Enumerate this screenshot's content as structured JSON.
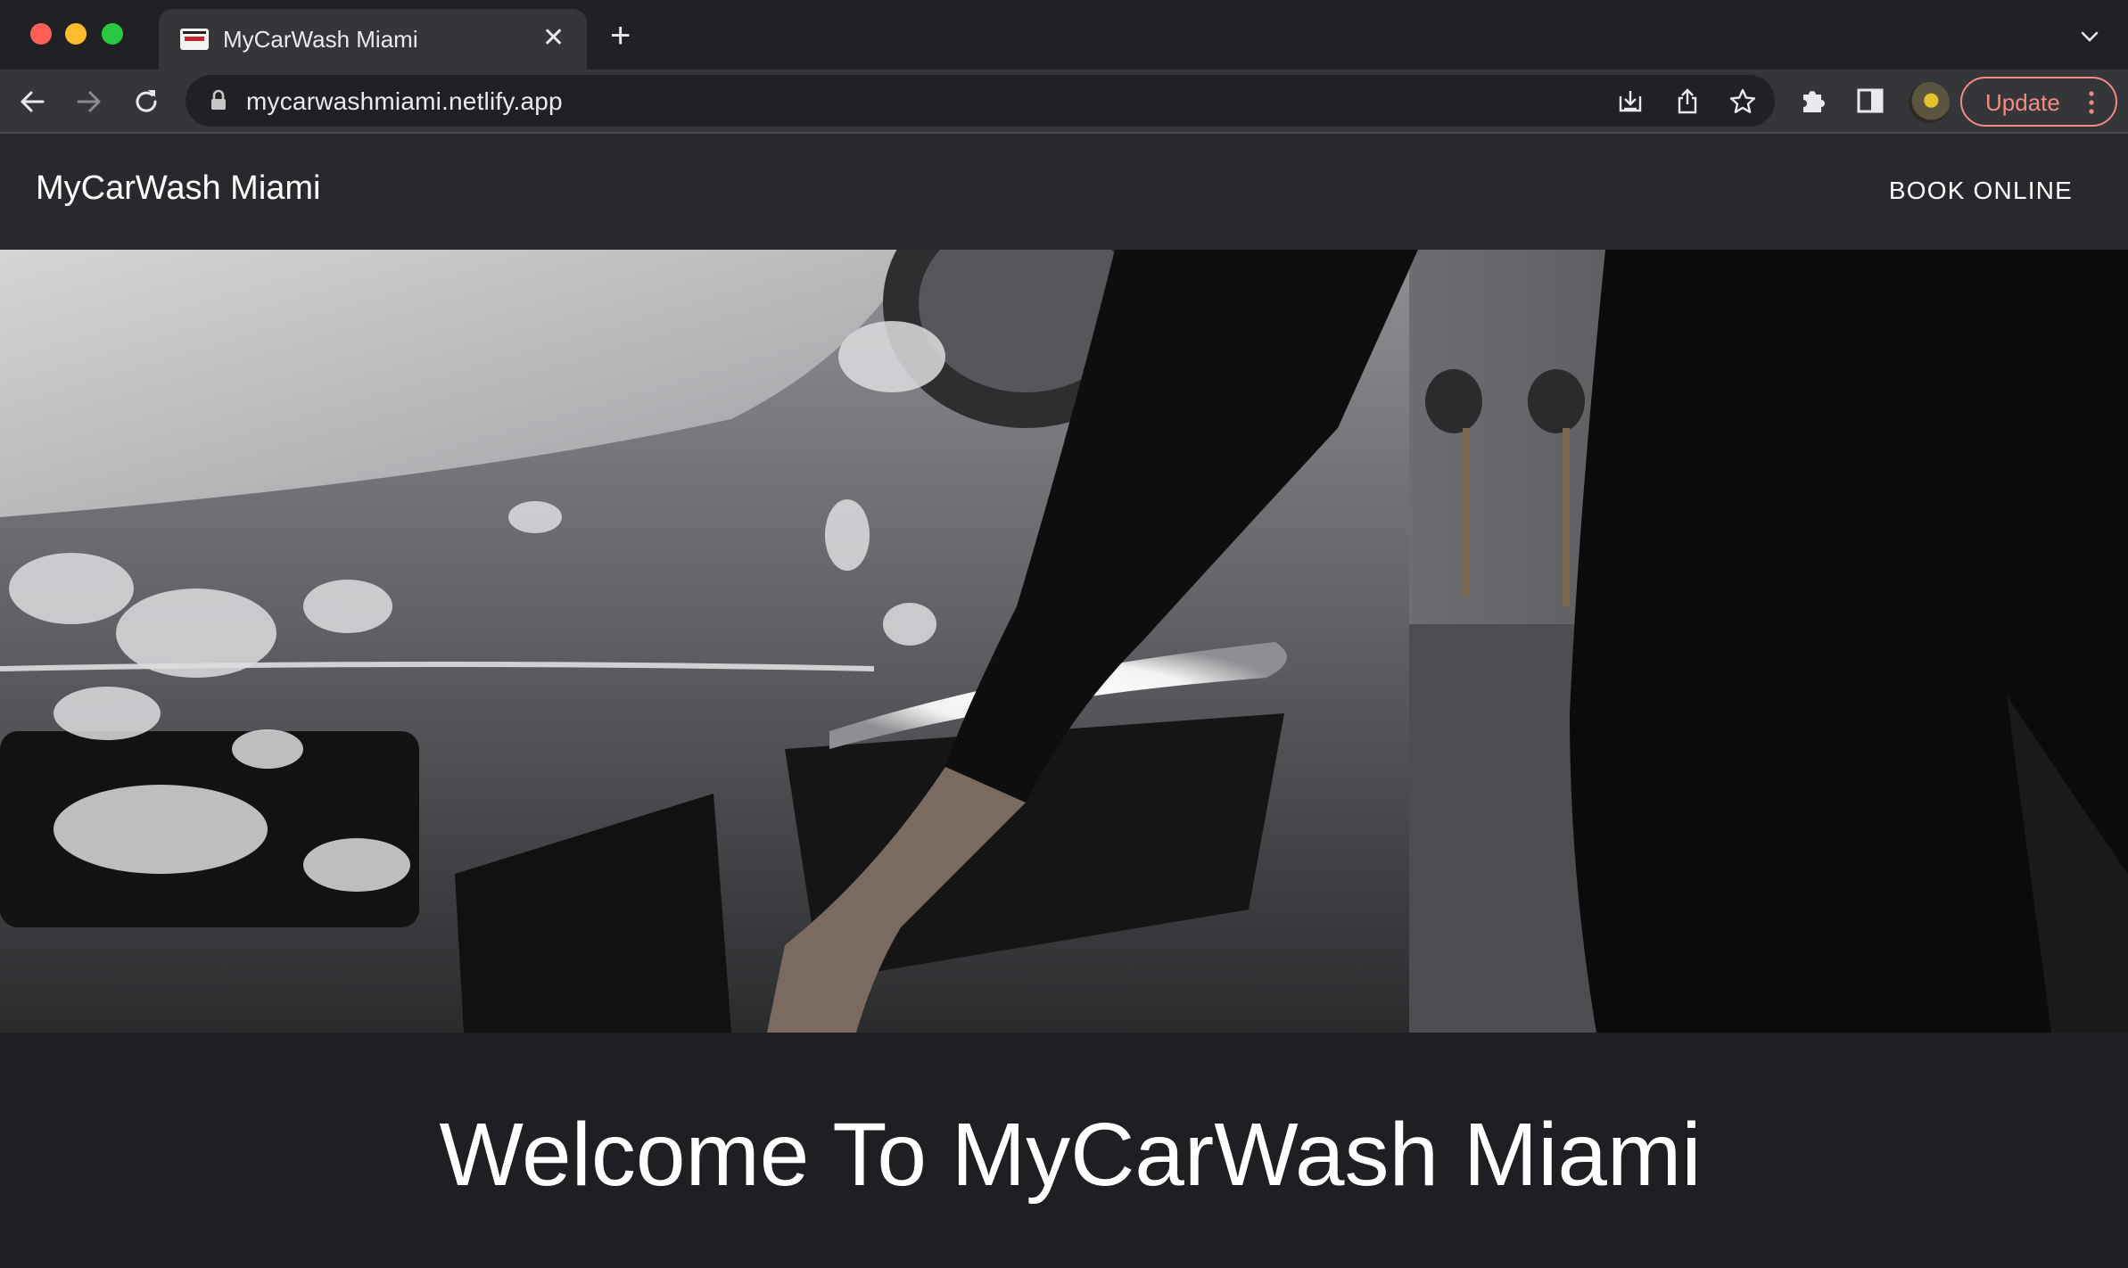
{
  "browser": {
    "tab_title": "MyCarWash Miami",
    "url": "mycarwashmiami.netlify.app",
    "update_label": "Update"
  },
  "site": {
    "brand": "MyCarWash Miami",
    "nav_book": "BOOK ONLINE",
    "welcome": "Welcome To MyCarWash Miami"
  },
  "hero": {
    "alt": "Person washing a soapy silver car"
  },
  "icons": {
    "back": "arrow-left-icon",
    "forward": "arrow-right-icon",
    "reload": "reload-icon",
    "lock": "lock-icon",
    "install": "install-icon",
    "share": "share-icon",
    "bookmark": "star-icon",
    "extensions": "puzzle-icon",
    "side_panel": "side-panel-icon",
    "menu": "kebab-menu-icon"
  },
  "colors": {
    "chrome_bg": "#202124",
    "toolbar_bg": "#35363a",
    "site_header_bg": "#29282d",
    "page_bg": "#1f1e23",
    "update_accent": "#f28b82"
  }
}
